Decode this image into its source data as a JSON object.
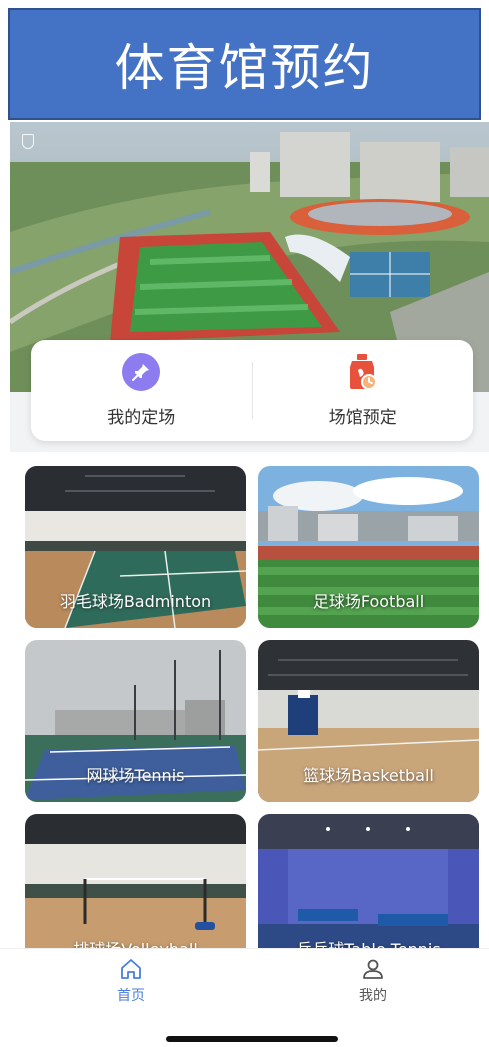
{
  "header": {
    "title": "体育馆预约"
  },
  "quick_actions": [
    {
      "label": "我的定场",
      "icon": "pin-icon"
    },
    {
      "label": "场馆预定",
      "icon": "booking-icon"
    }
  ],
  "venues": [
    {
      "label": "羽毛球场Badminton"
    },
    {
      "label": "足球场Football"
    },
    {
      "label": "网球场Tennis"
    },
    {
      "label": "篮球场Basketball"
    },
    {
      "label": "排球场Volleyball"
    },
    {
      "label": "乒乓球Table Tennis"
    }
  ],
  "tabbar": {
    "items": [
      {
        "label": "首页",
        "icon": "home-icon",
        "active": true
      },
      {
        "label": "我的",
        "icon": "user-icon",
        "active": false
      }
    ]
  },
  "colors": {
    "header_bg": "#4472c4",
    "accent": "#4a7ee0",
    "pin_bg": "#8c7cf0",
    "booking": "#e8523c"
  }
}
